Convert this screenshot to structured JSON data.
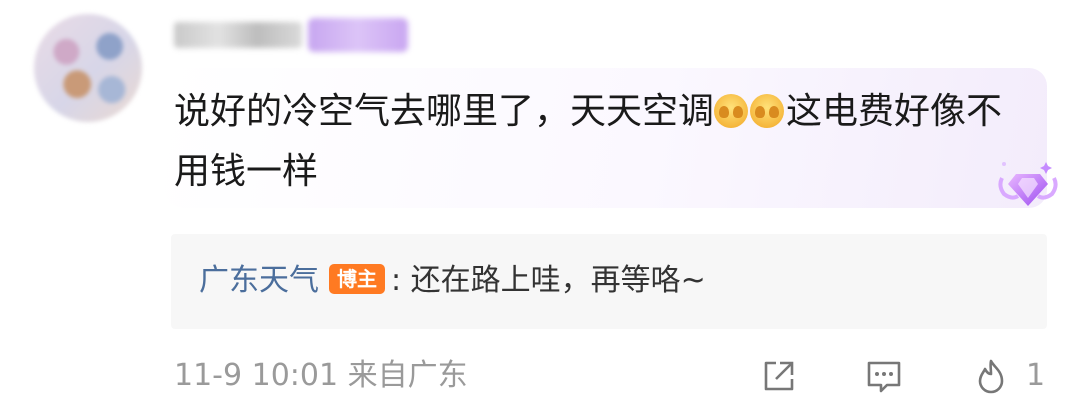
{
  "comment": {
    "text_part1": "说好的冷空气去哪里了，天天空调",
    "text_part2": "这电费好像不用钱一样",
    "emoji_icons": [
      "tired-face-icon",
      "tired-face-icon"
    ]
  },
  "reply": {
    "author": "广东天气",
    "author_tag": "博主",
    "text": ": 还在路上哇，再等咯~"
  },
  "footer": {
    "meta": "11-9 10:01 来自广东",
    "like_count": "1",
    "icons": [
      "share-icon",
      "comment-icon",
      "like-icon"
    ]
  },
  "colors": {
    "link_blue": "#4b6e9c",
    "host_tag_orange": "#ff7a22",
    "meta_gray": "#9a9a9a"
  }
}
